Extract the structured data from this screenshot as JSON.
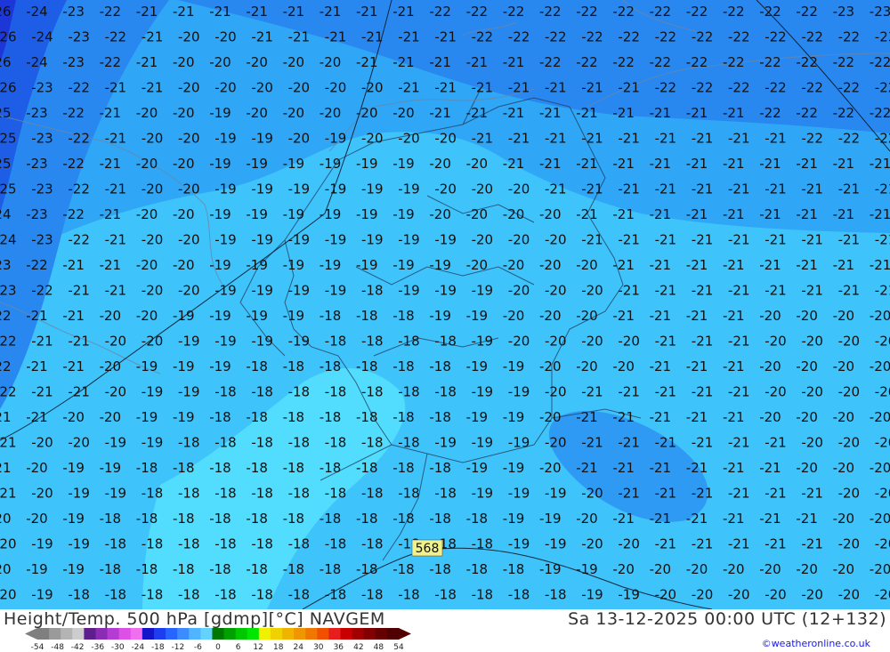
{
  "title_left": "Height/Temp. 500 hPa [gdmp][°C] NAVGEM",
  "title_right": "Sa 13-12-2025 00:00 UTC (12+132)",
  "credit": "©weatheronline.co.uk",
  "contour_label": "568",
  "legend": {
    "ticks": [
      "-54",
      "-48",
      "-42",
      "-36",
      "-30",
      "-24",
      "-18",
      "-12",
      "-6",
      "0",
      "6",
      "12",
      "18",
      "24",
      "30",
      "36",
      "42",
      "48",
      "54"
    ],
    "colors": [
      "#7f7f7f",
      "#9a9a9a",
      "#b4b4b4",
      "#cdcdcd",
      "#5e1e8c",
      "#8a2cb4",
      "#b43cd2",
      "#dc50e6",
      "#f06ef0",
      "#1414c8",
      "#1e3cf0",
      "#2864ff",
      "#3c8cff",
      "#50b4ff",
      "#64d2ff",
      "#007800",
      "#00a000",
      "#00c800",
      "#00e600",
      "#f0f000",
      "#f0d200",
      "#f0b400",
      "#f09600",
      "#f07800",
      "#f05000",
      "#e61e1e",
      "#c80000",
      "#a00000",
      "#820000",
      "#640000",
      "#500000"
    ]
  },
  "temperature_labels": [
    [
      "-26",
      "-24",
      "-23",
      "-22",
      "-21",
      "-21",
      "-21",
      "-21",
      "-21",
      "-21",
      "-21",
      "-21",
      "-22",
      "-22",
      "-22",
      "-22",
      "-22",
      "-22",
      "-22",
      "-22",
      "-22",
      "-22",
      "-22",
      "-23",
      "-23"
    ],
    [
      "-26",
      "-24",
      "-23",
      "-22",
      "-21",
      "-20",
      "-20",
      "-21",
      "-21",
      "-21",
      "-21",
      "-21",
      "-21",
      "-22",
      "-22",
      "-22",
      "-22",
      "-22",
      "-22",
      "-22",
      "-22",
      "-22",
      "-22",
      "-22",
      "-23"
    ],
    [
      "-26",
      "-24",
      "-23",
      "-22",
      "-21",
      "-20",
      "-20",
      "-20",
      "-20",
      "-20",
      "-21",
      "-21",
      "-21",
      "-21",
      "-21",
      "-22",
      "-22",
      "-22",
      "-22",
      "-22",
      "-22",
      "-22",
      "-22",
      "-22",
      "-22"
    ],
    [
      "-26",
      "-23",
      "-22",
      "-21",
      "-21",
      "-20",
      "-20",
      "-20",
      "-20",
      "-20",
      "-20",
      "-21",
      "-21",
      "-21",
      "-21",
      "-21",
      "-21",
      "-21",
      "-22",
      "-22",
      "-22",
      "-22",
      "-22",
      "-22",
      "-22"
    ],
    [
      "-25",
      "-23",
      "-22",
      "-21",
      "-20",
      "-20",
      "-19",
      "-20",
      "-20",
      "-20",
      "-20",
      "-20",
      "-21",
      "-21",
      "-21",
      "-21",
      "-21",
      "-21",
      "-21",
      "-21",
      "-21",
      "-22",
      "-22",
      "-22",
      "-22"
    ],
    [
      "-25",
      "-23",
      "-22",
      "-21",
      "-20",
      "-20",
      "-19",
      "-19",
      "-20",
      "-19",
      "-20",
      "-20",
      "-20",
      "-21",
      "-21",
      "-21",
      "-21",
      "-21",
      "-21",
      "-21",
      "-21",
      "-21",
      "-22",
      "-22",
      "-22"
    ],
    [
      "-25",
      "-23",
      "-22",
      "-21",
      "-20",
      "-20",
      "-19",
      "-19",
      "-19",
      "-19",
      "-19",
      "-19",
      "-20",
      "-20",
      "-21",
      "-21",
      "-21",
      "-21",
      "-21",
      "-21",
      "-21",
      "-21",
      "-21",
      "-21",
      "-21"
    ],
    [
      "-25",
      "-23",
      "-22",
      "-21",
      "-20",
      "-20",
      "-19",
      "-19",
      "-19",
      "-19",
      "-19",
      "-19",
      "-20",
      "-20",
      "-20",
      "-21",
      "-21",
      "-21",
      "-21",
      "-21",
      "-21",
      "-21",
      "-21",
      "-21",
      "-21"
    ],
    [
      "-24",
      "-23",
      "-22",
      "-21",
      "-20",
      "-20",
      "-19",
      "-19",
      "-19",
      "-19",
      "-19",
      "-19",
      "-20",
      "-20",
      "-20",
      "-20",
      "-21",
      "-21",
      "-21",
      "-21",
      "-21",
      "-21",
      "-21",
      "-21",
      "-21"
    ],
    [
      "-24",
      "-23",
      "-22",
      "-21",
      "-20",
      "-20",
      "-19",
      "-19",
      "-19",
      "-19",
      "-19",
      "-19",
      "-19",
      "-20",
      "-20",
      "-20",
      "-21",
      "-21",
      "-21",
      "-21",
      "-21",
      "-21",
      "-21",
      "-21",
      "-21"
    ],
    [
      "-23",
      "-22",
      "-21",
      "-21",
      "-20",
      "-20",
      "-19",
      "-19",
      "-19",
      "-19",
      "-19",
      "-19",
      "-19",
      "-20",
      "-20",
      "-20",
      "-20",
      "-21",
      "-21",
      "-21",
      "-21",
      "-21",
      "-21",
      "-21",
      "-21"
    ],
    [
      "-23",
      "-22",
      "-21",
      "-21",
      "-20",
      "-20",
      "-19",
      "-19",
      "-19",
      "-19",
      "-18",
      "-19",
      "-19",
      "-19",
      "-20",
      "-20",
      "-20",
      "-21",
      "-21",
      "-21",
      "-21",
      "-21",
      "-21",
      "-21",
      "-21"
    ],
    [
      "-22",
      "-21",
      "-21",
      "-20",
      "-20",
      "-19",
      "-19",
      "-19",
      "-19",
      "-18",
      "-18",
      "-18",
      "-19",
      "-19",
      "-20",
      "-20",
      "-20",
      "-21",
      "-21",
      "-21",
      "-21",
      "-20",
      "-20",
      "-20",
      "-20"
    ],
    [
      "-22",
      "-21",
      "-21",
      "-20",
      "-20",
      "-19",
      "-19",
      "-19",
      "-19",
      "-18",
      "-18",
      "-18",
      "-18",
      "-19",
      "-20",
      "-20",
      "-20",
      "-20",
      "-21",
      "-21",
      "-21",
      "-20",
      "-20",
      "-20",
      "-20"
    ],
    [
      "-22",
      "-21",
      "-21",
      "-20",
      "-19",
      "-19",
      "-19",
      "-18",
      "-18",
      "-18",
      "-18",
      "-18",
      "-18",
      "-19",
      "-19",
      "-20",
      "-20",
      "-20",
      "-21",
      "-21",
      "-21",
      "-20",
      "-20",
      "-20",
      "-20"
    ],
    [
      "-22",
      "-21",
      "-21",
      "-20",
      "-19",
      "-19",
      "-18",
      "-18",
      "-18",
      "-18",
      "-18",
      "-18",
      "-18",
      "-19",
      "-19",
      "-20",
      "-21",
      "-21",
      "-21",
      "-21",
      "-21",
      "-20",
      "-20",
      "-20",
      "-20"
    ],
    [
      "-21",
      "-21",
      "-20",
      "-20",
      "-19",
      "-19",
      "-18",
      "-18",
      "-18",
      "-18",
      "-18",
      "-18",
      "-18",
      "-19",
      "-19",
      "-20",
      "-21",
      "-21",
      "-21",
      "-21",
      "-21",
      "-20",
      "-20",
      "-20",
      "-20"
    ],
    [
      "-21",
      "-20",
      "-20",
      "-19",
      "-19",
      "-18",
      "-18",
      "-18",
      "-18",
      "-18",
      "-18",
      "-18",
      "-19",
      "-19",
      "-19",
      "-20",
      "-21",
      "-21",
      "-21",
      "-21",
      "-21",
      "-21",
      "-20",
      "-20",
      "-20"
    ],
    [
      "-21",
      "-20",
      "-19",
      "-19",
      "-18",
      "-18",
      "-18",
      "-18",
      "-18",
      "-18",
      "-18",
      "-18",
      "-18",
      "-19",
      "-19",
      "-20",
      "-21",
      "-21",
      "-21",
      "-21",
      "-21",
      "-21",
      "-20",
      "-20",
      "-20"
    ],
    [
      "-21",
      "-20",
      "-19",
      "-19",
      "-18",
      "-18",
      "-18",
      "-18",
      "-18",
      "-18",
      "-18",
      "-18",
      "-18",
      "-19",
      "-19",
      "-19",
      "-20",
      "-21",
      "-21",
      "-21",
      "-21",
      "-21",
      "-21",
      "-20",
      "-20"
    ],
    [
      "-20",
      "-20",
      "-19",
      "-18",
      "-18",
      "-18",
      "-18",
      "-18",
      "-18",
      "-18",
      "-18",
      "-18",
      "-18",
      "-18",
      "-19",
      "-19",
      "-20",
      "-21",
      "-21",
      "-21",
      "-21",
      "-21",
      "-21",
      "-20",
      "-20"
    ],
    [
      "-20",
      "-19",
      "-19",
      "-18",
      "-18",
      "-18",
      "-18",
      "-18",
      "-18",
      "-18",
      "-18",
      "-18",
      "-18",
      "-18",
      "-19",
      "-19",
      "-20",
      "-20",
      "-21",
      "-21",
      "-21",
      "-21",
      "-21",
      "-20",
      "-20"
    ],
    [
      "-20",
      "-19",
      "-19",
      "-18",
      "-18",
      "-18",
      "-18",
      "-18",
      "-18",
      "-18",
      "-18",
      "-18",
      "-18",
      "-18",
      "-18",
      "-19",
      "-19",
      "-20",
      "-20",
      "-20",
      "-20",
      "-20",
      "-20",
      "-20",
      "-20"
    ],
    [
      "-20",
      "-19",
      "-18",
      "-18",
      "-18",
      "-18",
      "-18",
      "-18",
      "-18",
      "-18",
      "-18",
      "-18",
      "-18",
      "-18",
      "-18",
      "-18",
      "-19",
      "-19",
      "-20",
      "-20",
      "-20",
      "-20",
      "-20",
      "-20",
      "-20"
    ]
  ]
}
